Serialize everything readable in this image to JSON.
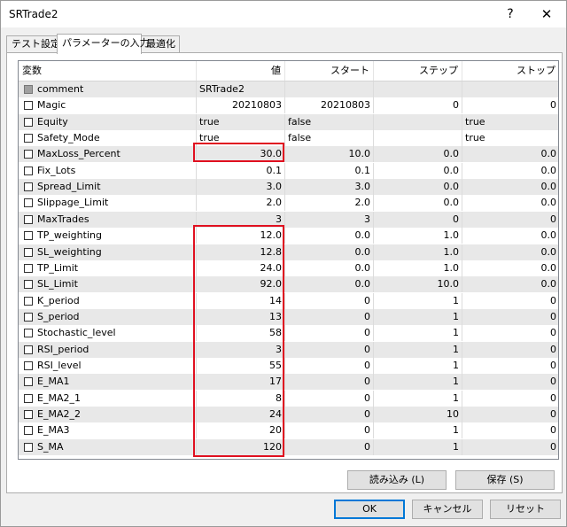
{
  "window": {
    "title": "SRTrade2",
    "help": "?",
    "close": "✕"
  },
  "tabs": [
    "テスト設定",
    "パラメーターの入力",
    "最適化"
  ],
  "columns": [
    "変数",
    "値",
    "スタート",
    "ステップ",
    "ストップ"
  ],
  "rows": [
    {
      "name": "comment",
      "value": "SRTrade2",
      "start": "",
      "step": "",
      "stop": "",
      "checkbox": "grey"
    },
    {
      "name": "Magic",
      "value": "20210803",
      "start": "20210803",
      "step": "0",
      "stop": "0"
    },
    {
      "name": "Equity",
      "value": "true",
      "start": "false",
      "step": "",
      "stop": "true"
    },
    {
      "name": "Safety_Mode",
      "value": "true",
      "start": "false",
      "step": "",
      "stop": "true"
    },
    {
      "name": "MaxLoss_Percent",
      "value": "30.0",
      "start": "10.0",
      "step": "0.0",
      "stop": "0.0"
    },
    {
      "name": "Fix_Lots",
      "value": "0.1",
      "start": "0.1",
      "step": "0.0",
      "stop": "0.0"
    },
    {
      "name": "Spread_Limit",
      "value": "3.0",
      "start": "3.0",
      "step": "0.0",
      "stop": "0.0"
    },
    {
      "name": "Slippage_Limit",
      "value": "2.0",
      "start": "2.0",
      "step": "0.0",
      "stop": "0.0"
    },
    {
      "name": "MaxTrades",
      "value": "3",
      "start": "3",
      "step": "0",
      "stop": "0"
    },
    {
      "name": "TP_weighting",
      "value": "12.0",
      "start": "0.0",
      "step": "1.0",
      "stop": "0.0"
    },
    {
      "name": "SL_weighting",
      "value": "12.8",
      "start": "0.0",
      "step": "1.0",
      "stop": "0.0"
    },
    {
      "name": "TP_Limit",
      "value": "24.0",
      "start": "0.0",
      "step": "1.0",
      "stop": "0.0"
    },
    {
      "name": "SL_Limit",
      "value": "92.0",
      "start": "0.0",
      "step": "10.0",
      "stop": "0.0"
    },
    {
      "name": "K_period",
      "value": "14",
      "start": "0",
      "step": "1",
      "stop": "0"
    },
    {
      "name": "S_period",
      "value": "13",
      "start": "0",
      "step": "1",
      "stop": "0"
    },
    {
      "name": "Stochastic_level",
      "value": "58",
      "start": "0",
      "step": "1",
      "stop": "0"
    },
    {
      "name": "RSI_period",
      "value": "3",
      "start": "0",
      "step": "1",
      "stop": "0"
    },
    {
      "name": "RSI_level",
      "value": "55",
      "start": "0",
      "step": "1",
      "stop": "0"
    },
    {
      "name": "E_MA1",
      "value": "17",
      "start": "0",
      "step": "1",
      "stop": "0"
    },
    {
      "name": "E_MA2_1",
      "value": "8",
      "start": "0",
      "step": "1",
      "stop": "0"
    },
    {
      "name": "E_MA2_2",
      "value": "24",
      "start": "0",
      "step": "10",
      "stop": "0"
    },
    {
      "name": "E_MA3",
      "value": "20",
      "start": "0",
      "step": "1",
      "stop": "0"
    },
    {
      "name": "S_MA",
      "value": "120",
      "start": "0",
      "step": "1",
      "stop": "0"
    }
  ],
  "buttons": {
    "load": "読み込み (L)",
    "save": "保存 (S)",
    "ok": "OK",
    "cancel": "キャンセル",
    "reset": "リセット"
  },
  "colors": {
    "highlight": "#e01020",
    "default_button_border": "#0078d7"
  }
}
